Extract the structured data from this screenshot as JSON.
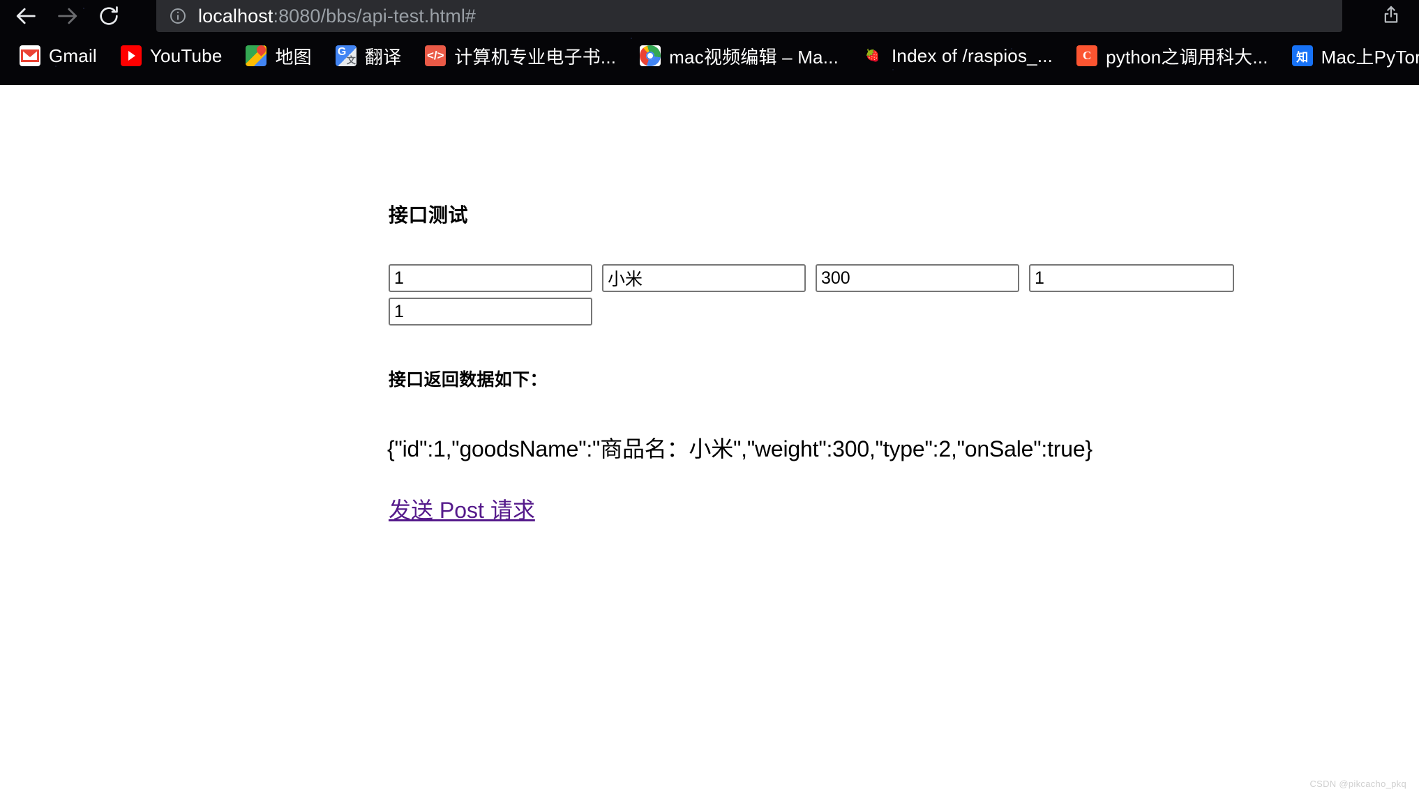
{
  "browser": {
    "nav": {
      "back_icon": "arrow-left-icon",
      "forward_icon": "arrow-right-icon",
      "reload_icon": "reload-icon",
      "share_icon": "share-upload-icon"
    },
    "omnibox": {
      "site_info_icon": "info-circle-icon",
      "host": "localhost",
      "path": ":8080/bbs/api-test.html#",
      "full_url": "localhost:8080/bbs/api-test.html#"
    },
    "bookmarks": [
      {
        "label": "Gmail",
        "icon": "gmail-icon"
      },
      {
        "label": "YouTube",
        "icon": "youtube-icon"
      },
      {
        "label": "地图",
        "icon": "google-maps-icon"
      },
      {
        "label": "翻译",
        "icon": "google-translate-icon"
      },
      {
        "label": "计算机专业电子书...",
        "icon": "code-brackets-icon"
      },
      {
        "label": "mac视频编辑 – Ma...",
        "icon": "chrome-icon"
      },
      {
        "label": "Index of /raspios_...",
        "icon": "raspberry-pi-icon"
      },
      {
        "label": "python之调用科大...",
        "icon": "csdn-icon"
      },
      {
        "label": "Mac上PyTorch安",
        "icon": "zhihu-icon"
      }
    ]
  },
  "page": {
    "title": "接口测试",
    "inputs": [
      {
        "name": "id",
        "value": "1"
      },
      {
        "name": "goodsName",
        "value": "小米"
      },
      {
        "name": "weight",
        "value": "300"
      },
      {
        "name": "type",
        "value": "1"
      },
      {
        "name": "onSale",
        "value": "1"
      }
    ],
    "result_label": "接口返回数据如下：",
    "result_json": "{\"id\":1,\"goodsName\":\"商品名：小米\",\"weight\":300,\"type\":2,\"onSale\":true}",
    "post_link": "发送 Post 请求",
    "link_color": "#551a8b",
    "watermark": "CSDN @pikcacho_pkq"
  }
}
